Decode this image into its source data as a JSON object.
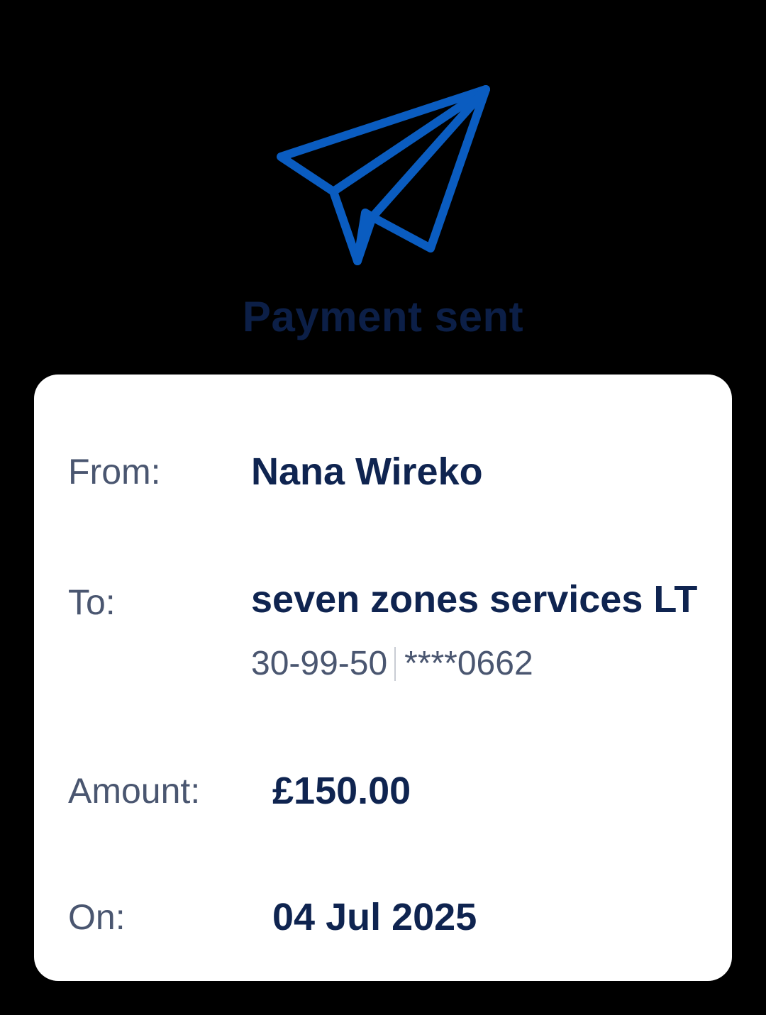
{
  "header": {
    "icon": "paper-plane-icon",
    "title": "Payment sent"
  },
  "details": {
    "from_label": "From:",
    "from_value": "Nana Wireko",
    "to_label": "To:",
    "to_value": "seven zones services LTD",
    "sort_code": "30-99-50",
    "account_number": "****0662",
    "amount_label": "Amount:",
    "amount_value": "£150.00",
    "on_label": "On:",
    "on_value": "04 Jul 2025"
  },
  "colors": {
    "background": "#000000",
    "accent": "#0a5cc0",
    "title": "#0c1f47",
    "value": "#0f2450",
    "label": "#4a5670",
    "card": "#ffffff"
  }
}
